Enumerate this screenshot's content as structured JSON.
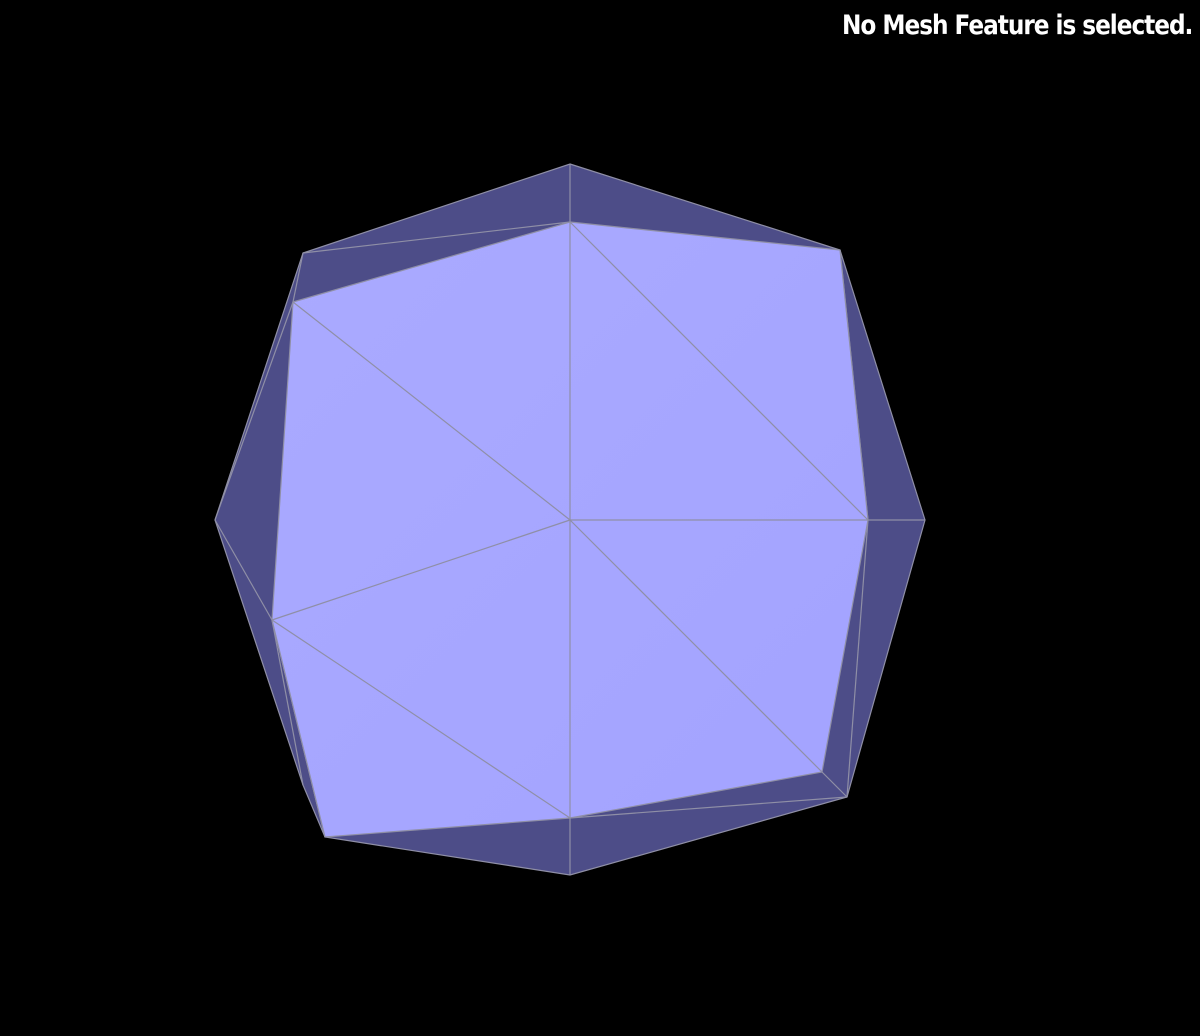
{
  "viewer": {
    "status_message": "No Mesh Feature is selected."
  },
  "colors": {
    "background": "#000000",
    "mesh_front": "#a6a6ff",
    "mesh_side": "#4d4d88",
    "mesh_edge": "#8f8fa6",
    "status_text": "#ffffff"
  }
}
